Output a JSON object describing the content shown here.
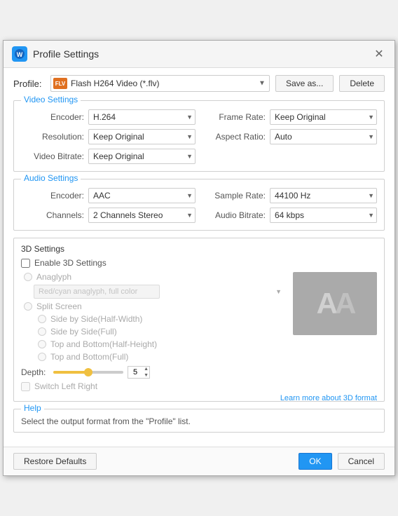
{
  "title": "Profile Settings",
  "close": "✕",
  "profile": {
    "label": "Profile:",
    "value": "Flash H264 Video (*.flv)",
    "icon": "FLV",
    "save_as": "Save as...",
    "delete": "Delete"
  },
  "video_settings": {
    "section_title": "Video Settings",
    "encoder_label": "Encoder:",
    "encoder_value": "H.264",
    "frame_rate_label": "Frame Rate:",
    "frame_rate_value": "Keep Original",
    "resolution_label": "Resolution:",
    "resolution_value": "Keep Original",
    "aspect_ratio_label": "Aspect Ratio:",
    "aspect_ratio_value": "Auto",
    "video_bitrate_label": "Video Bitrate:",
    "video_bitrate_value": "Keep Original"
  },
  "audio_settings": {
    "section_title": "Audio Settings",
    "encoder_label": "Encoder:",
    "encoder_value": "AAC",
    "sample_rate_label": "Sample Rate:",
    "sample_rate_value": "44100 Hz",
    "channels_label": "Channels:",
    "channels_value": "2 Channels Stereo",
    "audio_bitrate_label": "Audio Bitrate:",
    "audio_bitrate_value": "64 kbps"
  },
  "three_d_settings": {
    "section_title": "3D Settings",
    "enable_label": "Enable 3D Settings",
    "anaglyph_label": "Anaglyph",
    "anaglyph_value": "Red/cyan anaglyph, full color",
    "split_screen_label": "Split Screen",
    "side_by_side_half": "Side by Side(Half-Width)",
    "side_by_side_full": "Side by Side(Full)",
    "top_bottom_half": "Top and Bottom(Half-Height)",
    "top_bottom_full": "Top and Bottom(Full)",
    "depth_label": "Depth:",
    "depth_value": "5",
    "switch_label": "Switch Left Right",
    "learn_more": "Learn more about 3D format",
    "preview_left": "A",
    "preview_right": "A"
  },
  "help": {
    "section_title": "Help",
    "text": "Select the output format from the \"Profile\" list."
  },
  "footer": {
    "restore_defaults": "Restore Defaults",
    "ok": "OK",
    "cancel": "Cancel"
  }
}
